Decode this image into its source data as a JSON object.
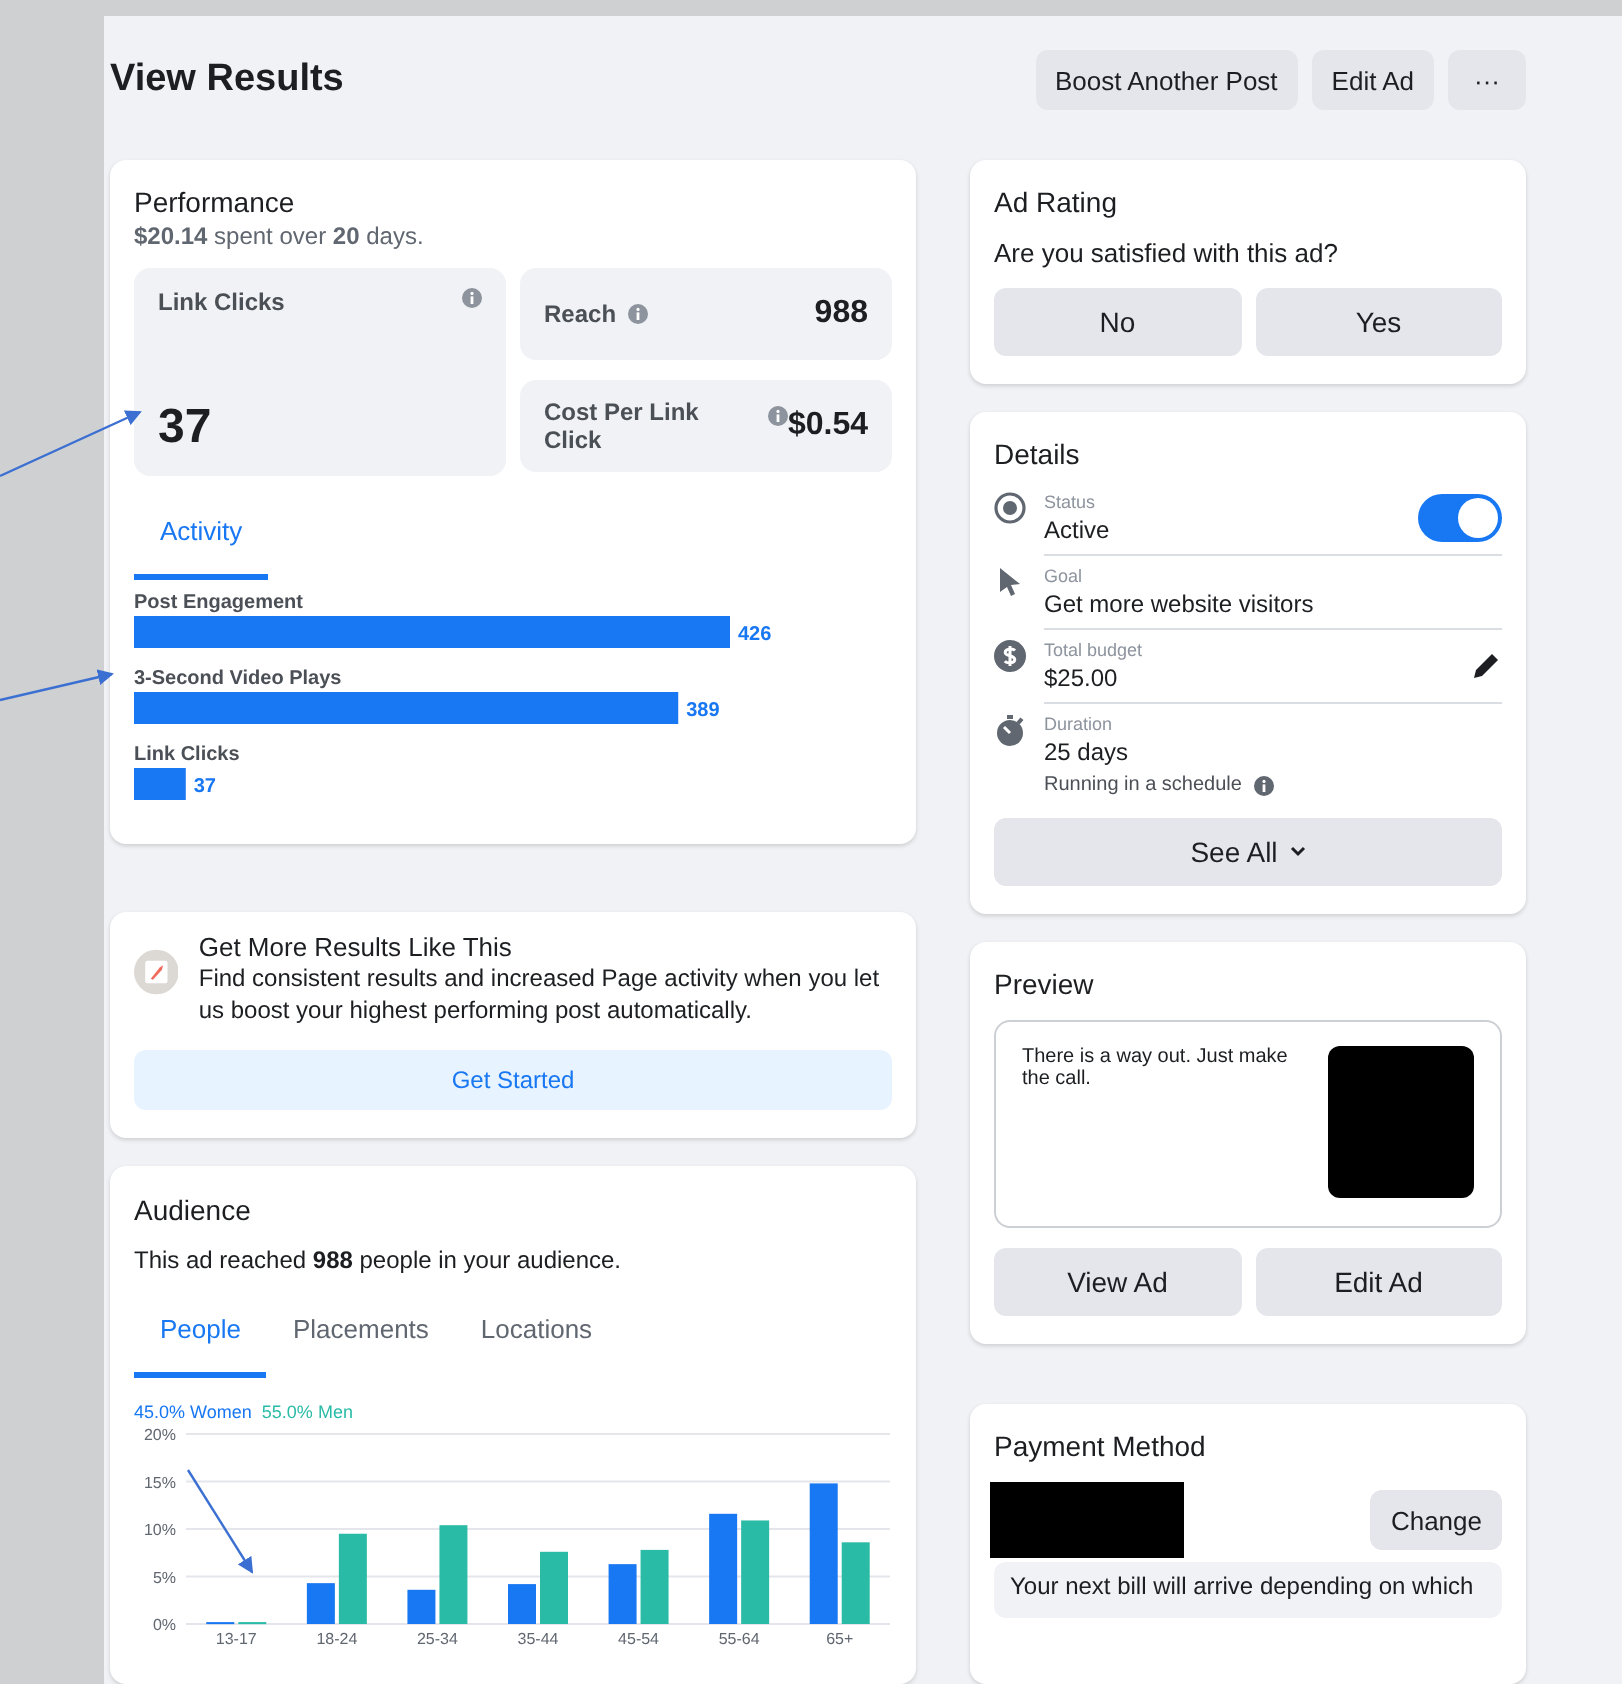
{
  "header": {
    "title": "View Results",
    "buttons": [
      {
        "label": "Boost Another Post",
        "kind": "text"
      },
      {
        "label": "Edit Ad",
        "kind": "text"
      },
      {
        "label": "···",
        "kind": "more"
      }
    ]
  },
  "performance": {
    "title": "Performance",
    "summary": "**$20.14** spent over **20** days.",
    "metrics": [
      {
        "label": "Link Clicks",
        "value": "37",
        "kind": "big"
      },
      {
        "label": "Reach",
        "value": "988",
        "kind": "inline"
      },
      {
        "label": "Cost Per Link Click",
        "value": "$0.54",
        "kind": "side"
      }
    ],
    "tabs": [
      {
        "label": "Activity",
        "selected": true
      }
    ],
    "chart_data": {
      "type": "bar",
      "orientation": "horizontal",
      "categories": [
        "Post Engagement",
        "3-Second Video Plays",
        "Link Clicks"
      ],
      "values": [
        426,
        389,
        37
      ],
      "data_labels": true
    }
  },
  "promo": {
    "title": "Get More Results Like This",
    "text": "Find consistent results and increased Page activity when you let us boost your highest performing post automatically.",
    "button": "Get Started"
  },
  "audience": {
    "title": "Audience",
    "summary": "This ad reached **988** people in your audience.",
    "tabs": [
      {
        "label": "People",
        "selected": true
      },
      {
        "label": "Placements",
        "selected": false
      },
      {
        "label": "Locations",
        "selected": false
      }
    ],
    "shares": [
      "45.0%",
      "55.0%"
    ],
    "chart_data": {
      "type": "bar",
      "grid": true,
      "categories": [
        "13-17",
        "18-24",
        "25-34",
        "35-44",
        "45-54",
        "55-64",
        "65+"
      ],
      "series": [
        {
          "name": "Women",
          "color": "#1877f2",
          "values": [
            0.2,
            4.3,
            3.6,
            4.2,
            6.3,
            11.6,
            14.8
          ]
        },
        {
          "name": "Men",
          "color": "#2abba7",
          "values": [
            0.2,
            9.5,
            10.4,
            7.6,
            7.8,
            10.9,
            8.6
          ]
        }
      ],
      "ylim": [
        0,
        20
      ],
      "yticks": [
        {
          "value": 0,
          "label": "0%"
        },
        {
          "value": 5,
          "label": "5%"
        },
        {
          "value": 10,
          "label": "10%"
        },
        {
          "value": 15,
          "label": "15%"
        },
        {
          "value": 20,
          "label": "20%"
        }
      ]
    }
  },
  "ad_rating": {
    "title": "Ad Rating",
    "question": "Are you satisfied with this ad?",
    "buttons": [
      "No",
      "Yes"
    ]
  },
  "details": {
    "title": "Details",
    "items": [
      {
        "kind": "status",
        "label": "Status",
        "value": "Active",
        "on": true
      },
      {
        "kind": "goal",
        "label": "Goal",
        "value": "Get more website visitors"
      },
      {
        "kind": "budget",
        "label": "Total budget",
        "value": "$25.00",
        "editable": true
      },
      {
        "kind": "duration",
        "label": "Duration",
        "value": "25 days",
        "note": "Running in a schedule"
      }
    ],
    "button": "See All"
  },
  "preview": {
    "title": "Preview",
    "text": "There is a way out. Just make the call.",
    "buttons": [
      "View Ad",
      "Edit Ad"
    ]
  },
  "payment": {
    "title": "Payment Method",
    "button": "Change",
    "note": "Your next bill will arrive depending on which"
  }
}
